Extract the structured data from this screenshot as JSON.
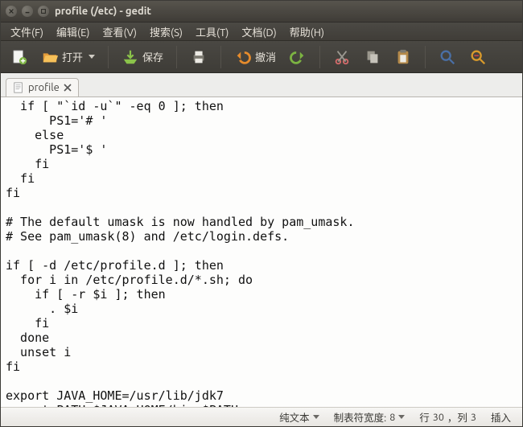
{
  "window": {
    "title": "profile (/etc) - gedit"
  },
  "menus": {
    "file": "文件(F)",
    "edit": "编辑(E)",
    "view": "查看(V)",
    "search": "搜索(S)",
    "tools": "工具(T)",
    "documents": "文档(D)",
    "help": "帮助(H)"
  },
  "toolbar": {
    "open": "打开",
    "save": "保存",
    "undo": "撤消"
  },
  "tab": {
    "label": "profile"
  },
  "editor": {
    "content": "  if [ \"`id -u`\" -eq 0 ]; then\n      PS1='# '\n    else\n      PS1='$ '\n    fi\n  fi\nfi\n\n# The default umask is now handled by pam_umask.\n# See pam_umask(8) and /etc/login.defs.\n\nif [ -d /etc/profile.d ]; then\n  for i in /etc/profile.d/*.sh; do\n    if [ -r $i ]; then\n      . $i\n    fi\n  done\n  unset i\nfi\n\nexport JAVA_HOME=/usr/lib/jdk7\nexport PATH=$JAVA_HOME/bin:$PATH"
  },
  "status": {
    "syntax": "纯文本",
    "tabwidth_label": "制表符宽度: ",
    "tabwidth_value": "8",
    "line_label": "行 ",
    "line_value": "30",
    "col_label": "，列 ",
    "col_value": "3",
    "mode": "插入"
  }
}
